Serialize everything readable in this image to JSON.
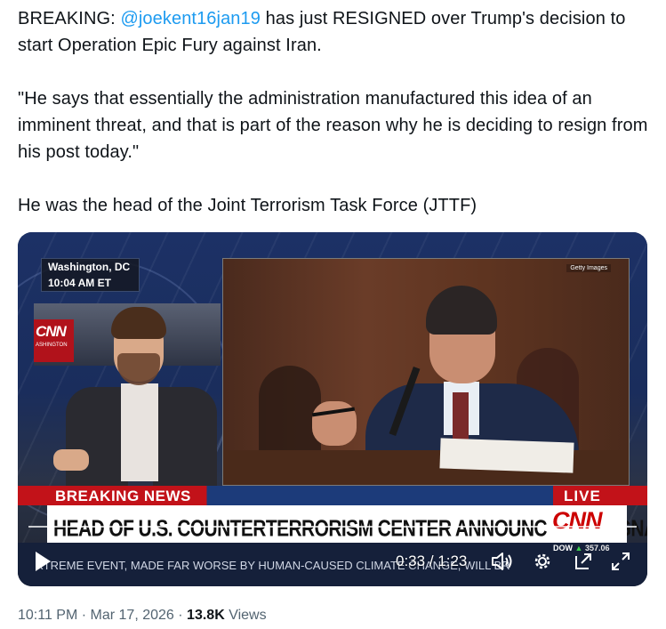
{
  "tweet": {
    "p1_prefix": "BREAKING: ",
    "p1_mention": "@joekent16jan19",
    "p1_suffix": " has just RESIGNED over Trump's decision to start Operation Epic Fury against Iran.",
    "p2": "\"He says that essentially the administration manufactured this idea of an imminent threat, and that is part of the reason why he is deciding to resign from his post today.\"",
    "p3": "He was the head of the Joint Terrorism Task Force (JTTF)"
  },
  "video": {
    "location": "Washington, DC",
    "local_time": "10:04 AM ET",
    "wall_logo": "CNN",
    "wall_sub": "ASHINGTON",
    "photo_credit": "Getty Images",
    "banner": "BREAKING NEWS",
    "live": "LIVE",
    "headline": "HEAD OF U.S. COUNTERTERRORISM CENTER ANNOUNCES RESIGNATION",
    "network_logo": "CNN",
    "ticker": "XTREME EVENT, MADE FAR WORSE BY HUMAN-CAUSED CLIMATE CHANGE, WILL BR",
    "dow_label": "DOW",
    "dow_value": "357.06",
    "time_current": "0:33",
    "time_total": "1:23",
    "icons": [
      "play-icon",
      "volume-icon",
      "settings-gear-icon",
      "popout-icon",
      "fullscreen-icon"
    ]
  },
  "footer": {
    "time": "10:11 PM",
    "date": "Mar 17, 2026",
    "views_count": "13.8K",
    "views_label": "Views"
  },
  "colors": {
    "mention": "#1d9bf0",
    "text": "#0f1419",
    "meta": "#536471",
    "cnn_red": "#cc0000"
  }
}
